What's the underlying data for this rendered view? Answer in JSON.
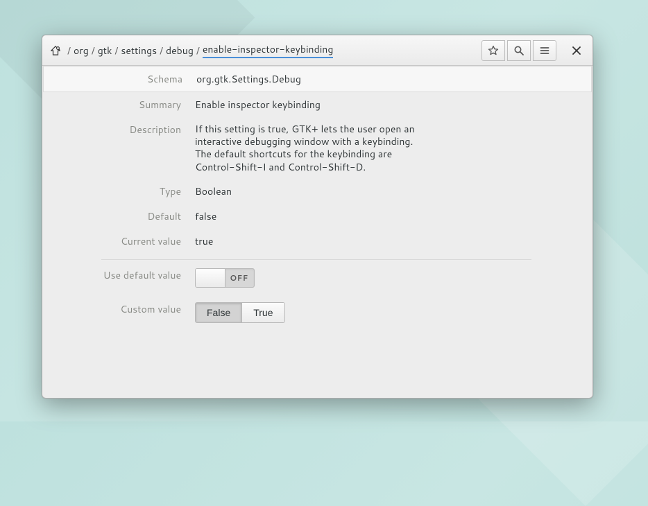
{
  "breadcrumb": {
    "segments": [
      "org",
      "gtk",
      "settings",
      "debug"
    ],
    "current": "enable-inspector-keybinding"
  },
  "fields": {
    "schema_label": "Schema",
    "schema_value": "org.gtk.Settings.Debug",
    "summary_label": "Summary",
    "summary_value": "Enable inspector keybinding",
    "description_label": "Description",
    "description_value": "If this setting is true, GTK+ lets the user open an interactive debugging window with a keybinding. The default shortcuts for the keybinding are Control-Shift-I and Control-Shift-D.",
    "type_label": "Type",
    "type_value": "Boolean",
    "default_label": "Default",
    "default_value": "false",
    "current_label": "Current value",
    "current_value": "true",
    "use_default_label": "Use default value",
    "custom_value_label": "Custom value"
  },
  "switch": {
    "off_text": "OFF",
    "state": "off"
  },
  "custom_value_options": {
    "false": "False",
    "true": "True",
    "selected": "false"
  }
}
